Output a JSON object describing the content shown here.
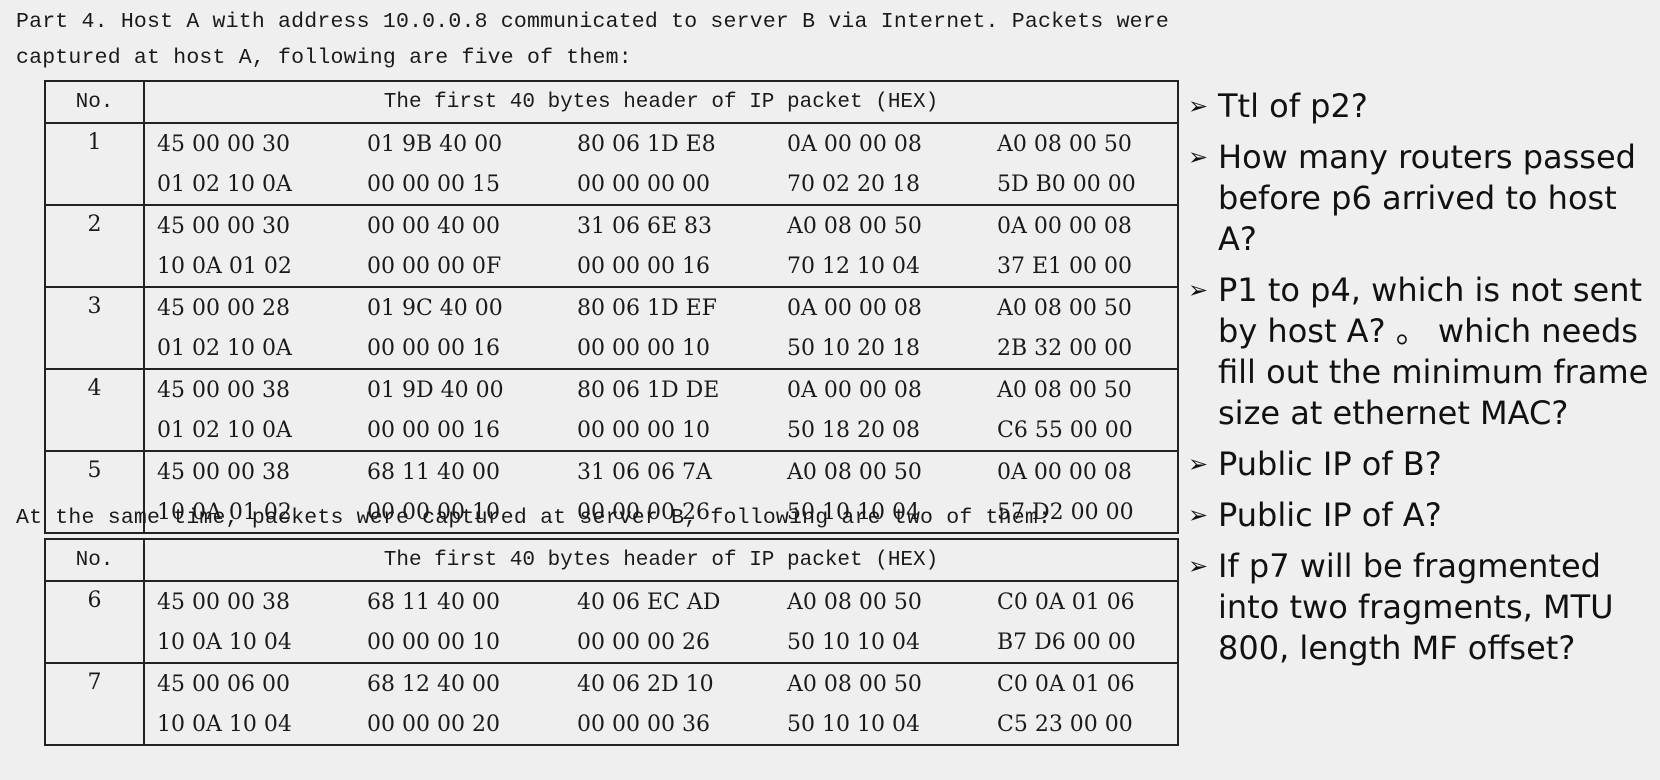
{
  "intro": {
    "line1": "Part 4. Host A with address 10.0.0.8 communicated to server B via Internet. Packets were",
    "line2": "captured at host A, following are five of them:"
  },
  "table1": {
    "col_no": "No.",
    "col_header": "The first 40 bytes header of IP packet (HEX)",
    "packets": [
      {
        "no": "1",
        "rows": [
          [
            "45 00 00 30",
            "01 9B 40 00",
            "80 06 1D E8",
            "0A 00 00 08",
            "A0 08 00 50"
          ],
          [
            "01 02 10 0A",
            "00 00 00 15",
            "00 00 00 00",
            "70 02 20 18",
            "5D B0 00 00"
          ]
        ]
      },
      {
        "no": "2",
        "rows": [
          [
            "45 00 00 30",
            "00 00 40 00",
            "31 06 6E 83",
            "A0 08 00 50",
            "0A 00 00 08"
          ],
          [
            "10 0A 01 02",
            "00 00 00 0F",
            "00 00 00 16",
            "70 12 10 04",
            "37 E1 00 00"
          ]
        ]
      },
      {
        "no": "3",
        "rows": [
          [
            "45 00 00 28",
            "01 9C 40 00",
            "80 06 1D EF",
            "0A 00 00 08",
            "A0 08 00 50"
          ],
          [
            "01 02 10 0A",
            "00 00 00 16",
            "00 00 00 10",
            "50 10 20 18",
            "2B 32 00 00"
          ]
        ]
      },
      {
        "no": "4",
        "rows": [
          [
            "45 00 00 38",
            "01 9D 40 00",
            "80 06 1D DE",
            "0A 00 00 08",
            "A0 08 00 50"
          ],
          [
            "01 02 10 0A",
            "00 00 00 16",
            "00 00 00 10",
            "50 18 20 08",
            "C6 55 00 00"
          ]
        ]
      },
      {
        "no": "5",
        "rows": [
          [
            "45 00 00 38",
            "68 11 40 00",
            "31 06 06 7A",
            "A0 08 00 50",
            "0A 00 00 08"
          ],
          [
            "10 0A 01 02",
            "00 00 00 10",
            "00 00 00 26",
            "50 10 10 04",
            "57 D2 00 00"
          ]
        ]
      }
    ]
  },
  "middle_text": "At the same time, packets were captured at server B, following are two of them:",
  "table2": {
    "col_no": "No.",
    "col_header": "The first 40 bytes header of IP packet (HEX)",
    "packets": [
      {
        "no": "6",
        "rows": [
          [
            "45 00 00 38",
            "68 11 40 00",
            "40 06 EC AD",
            "A0 08 00 50",
            "C0 0A 01 06"
          ],
          [
            "10 0A 10 04",
            "00 00 00 10",
            "00 00 00 26",
            "50 10 10 04",
            "B7 D6 00 00"
          ]
        ]
      },
      {
        "no": "7",
        "rows": [
          [
            "45 00 06 00",
            "68 12 40 00",
            "40 06 2D 10",
            "A0 08 00 50",
            "C0 0A 01 06"
          ],
          [
            "10 0A 10 04",
            "00 00 00 20",
            "00 00 00 36",
            "50 10 10 04",
            "C5 23 00 00"
          ]
        ]
      }
    ]
  },
  "questions": [
    "Ttl of p2?",
    "How many routers passed before p6 arrived to host A?",
    "P1 to p4, which is not sent by host A? 。 which needs fill out the minimum frame size at ethernet MAC?",
    "Public IP of B?",
    "Public IP of A?",
    "If p7 will be fragmented into two fragments, MTU 800, length MF offset?"
  ]
}
